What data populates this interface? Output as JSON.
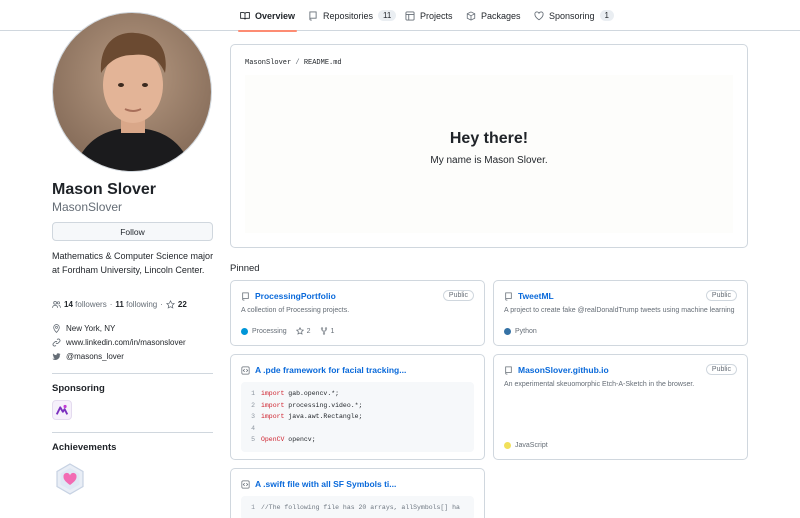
{
  "nav": {
    "tabs": [
      {
        "label": "Overview",
        "icon": "book-icon",
        "active": true
      },
      {
        "label": "Repositories",
        "icon": "repo-icon",
        "count": "11"
      },
      {
        "label": "Projects",
        "icon": "table-icon"
      },
      {
        "label": "Packages",
        "icon": "package-icon"
      },
      {
        "label": "Sponsoring",
        "icon": "heart-icon",
        "count": "1"
      }
    ]
  },
  "profile": {
    "name": "Mason Slover",
    "username": "MasonSlover",
    "follow_label": "Follow",
    "bio": "Mathematics & Computer Science major at Fordham University, Lincoln Center.",
    "followers_count": "14",
    "followers_label": "followers",
    "following_count": "11",
    "following_label": "following",
    "stars_count": "22",
    "separator": "·",
    "location": "New York, NY",
    "linkedin": "www.linkedin.com/in/masonslover",
    "twitter": "@masons_lover"
  },
  "sidebar": {
    "sponsoring_title": "Sponsoring",
    "achievements_title": "Achievements"
  },
  "readme": {
    "owner": "MasonSlover",
    "separator": "/",
    "file": "README.md",
    "heading": "Hey there!",
    "subheading": "My name is Mason Slover."
  },
  "pinned": {
    "label": "Pinned",
    "items": [
      {
        "title": "ProcessingPortfolio",
        "badge": "Public",
        "description": "A collection of Processing projects.",
        "language": "Processing",
        "language_color": "#0096d8",
        "stars": "2",
        "forks": "1"
      },
      {
        "title": "TweetML",
        "badge": "Public",
        "description": "A project to create fake @realDonaldTrump tweets using machine learning",
        "language": "Python",
        "language_color": "#3572a5"
      },
      {
        "title": "A .pde framework for facial tracking...",
        "code_lines": [
          {
            "n": "1",
            "kw": "import",
            "rest": " gab.opencv.*;"
          },
          {
            "n": "2",
            "kw": "import",
            "rest": " processing.video.*;"
          },
          {
            "n": "3",
            "kw": "import",
            "rest": " java.awt.Rectangle;"
          },
          {
            "n": "4",
            "kw": "",
            "rest": ""
          },
          {
            "n": "5",
            "kw": "OpenCV",
            "rest": " opencv;"
          }
        ]
      },
      {
        "title": "MasonSlover.github.io",
        "badge": "Public",
        "description": "An experimental skeuomorphic Etch-A-Sketch in the browser.",
        "language": "JavaScript",
        "language_color": "#f1e05a"
      },
      {
        "title": "A .swift file with all SF Symbols ti...",
        "code_lines": [
          {
            "n": "1",
            "comment": "//The following file has 20 arrays, allSymbols[] ha"
          }
        ]
      }
    ]
  }
}
